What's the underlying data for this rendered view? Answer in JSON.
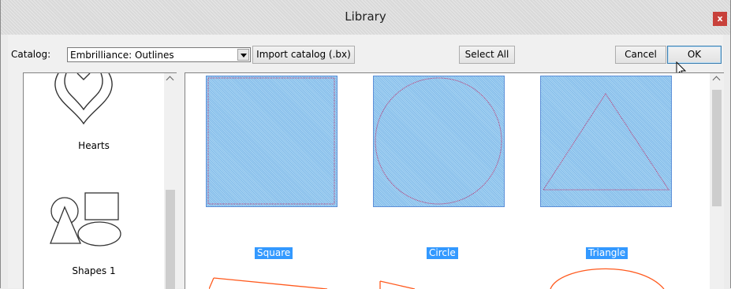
{
  "window": {
    "title": "Library",
    "close_glyph": "x"
  },
  "toolbar": {
    "catalog_label": "Catalog:",
    "catalog_value": "Embrilliance: Outlines",
    "import_label": "Import catalog (.bx)",
    "select_all_label": "Select All",
    "cancel_label": "Cancel",
    "ok_label": "OK"
  },
  "categories": [
    {
      "label": "Hearts",
      "icon": "hearts-icon"
    },
    {
      "label": "Shapes 1",
      "icon": "shapes-icon"
    }
  ],
  "items": [
    {
      "label": "Square",
      "selected": true
    },
    {
      "label": "Circle",
      "selected": true
    },
    {
      "label": "Triangle",
      "selected": true
    }
  ],
  "colors": {
    "selection": "#3399ff",
    "outline": "#ff5a1e",
    "stitch": "#c0306a"
  }
}
